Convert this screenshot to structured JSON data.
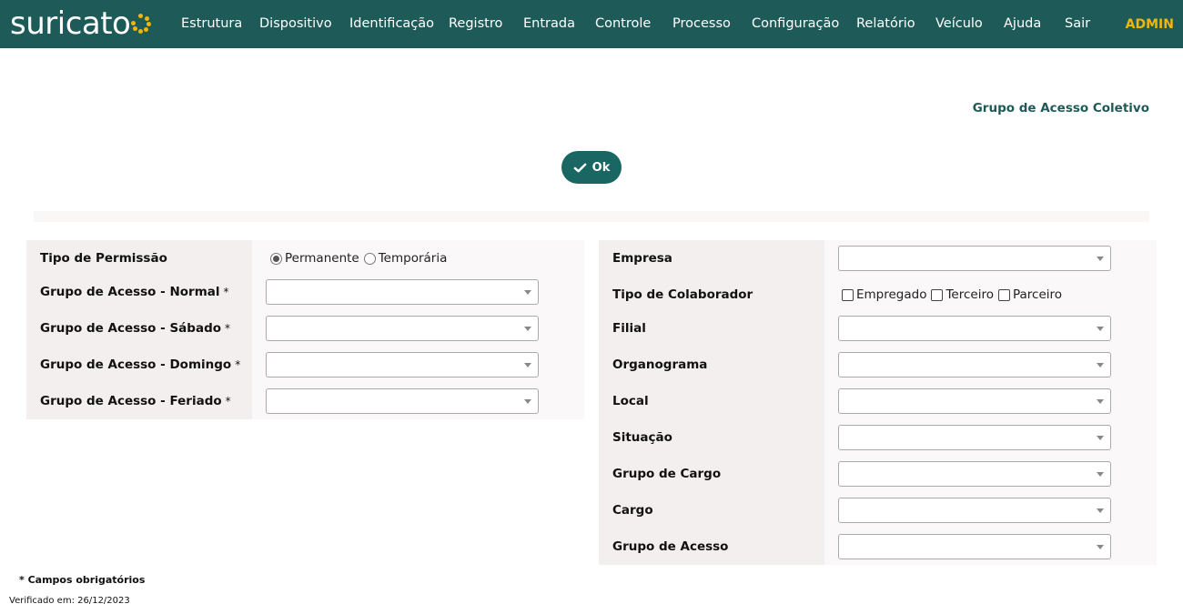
{
  "brand": {
    "name": "suricato",
    "accent": "#f2b705",
    "header_bg": "#1e5b58"
  },
  "nav": {
    "items": [
      "Estrutura",
      "Dispositivo",
      "Identificação",
      "Registro",
      "Entrada",
      "Controle",
      "Processo",
      "Configuração",
      "Relatório",
      "Veículo",
      "Ajuda",
      "Sair"
    ],
    "user": "ADMIN"
  },
  "page": {
    "title": "Grupo de Acesso Coletivo",
    "ok_label": "Ok",
    "ok_icon": "check-icon"
  },
  "left_form": {
    "tipo_permissao": {
      "label": "Tipo de Permissão",
      "options": [
        "Permanente",
        "Temporária"
      ],
      "selected": "Permanente"
    },
    "grupo_normal": {
      "label": "Grupo de Acesso - Normal",
      "required_mark": "*",
      "value": ""
    },
    "grupo_sabado": {
      "label": "Grupo de Acesso - Sábado",
      "required_mark": "*",
      "value": ""
    },
    "grupo_domingo": {
      "label": "Grupo de Acesso - Domingo",
      "required_mark": "*",
      "value": ""
    },
    "grupo_feriado": {
      "label": "Grupo de Acesso - Feriado",
      "required_mark": "*",
      "value": ""
    }
  },
  "right_form": {
    "empresa": {
      "label": "Empresa",
      "value": ""
    },
    "tipo_colaborador": {
      "label": "Tipo de Colaborador",
      "options": [
        "Empregado",
        "Terceiro",
        "Parceiro"
      ],
      "checked": []
    },
    "filial": {
      "label": "Filial",
      "value": ""
    },
    "organograma": {
      "label": "Organograma",
      "value": ""
    },
    "local": {
      "label": "Local",
      "value": ""
    },
    "situacao": {
      "label": "Situação",
      "value": ""
    },
    "grupo_cargo": {
      "label": "Grupo de Cargo",
      "value": ""
    },
    "cargo": {
      "label": "Cargo",
      "value": ""
    },
    "grupo_acesso": {
      "label": "Grupo de Acesso",
      "value": ""
    }
  },
  "footer": {
    "required_note": "* Campos obrigatórios",
    "verified": "Verificado em: 26/12/2023"
  }
}
